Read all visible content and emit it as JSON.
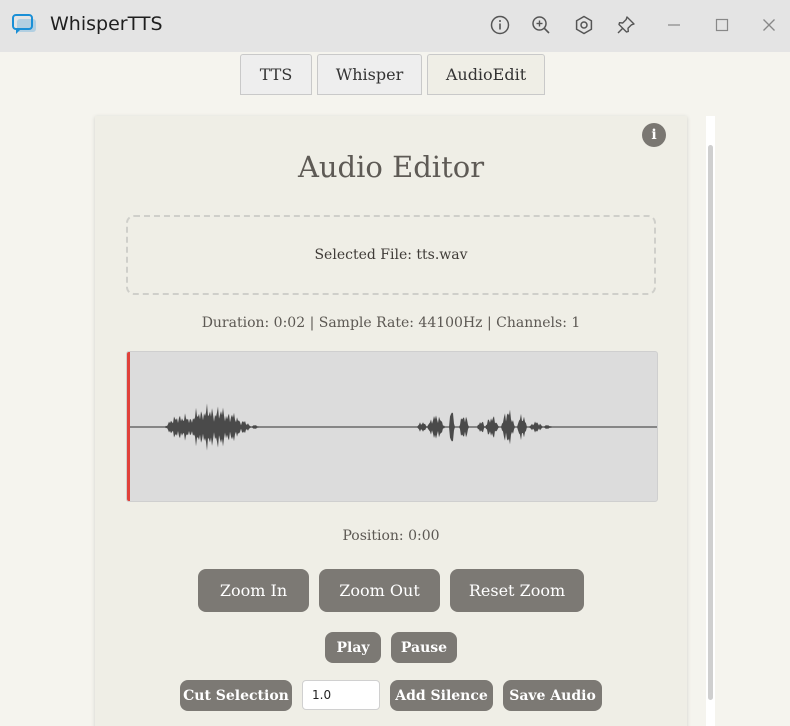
{
  "window": {
    "title": "WhisperTTS"
  },
  "tabs": [
    {
      "label": "TTS",
      "active": false
    },
    {
      "label": "Whisper",
      "active": false
    },
    {
      "label": "AudioEdit",
      "active": true
    }
  ],
  "editor": {
    "title": "Audio Editor",
    "info_label": "i",
    "selected_file": "Selected File: tts.wav",
    "meta": "Duration: 0:02 | Sample Rate: 44100Hz | Channels: 1",
    "position": "Position: 0:00"
  },
  "zoom_buttons": {
    "zoom_in": "Zoom In",
    "zoom_out": "Zoom Out",
    "reset_zoom": "Reset Zoom"
  },
  "playback": {
    "play": "Play",
    "pause": "Pause"
  },
  "edit": {
    "cut_selection": "Cut Selection",
    "silence_value": "1.0",
    "add_silence": "Add Silence",
    "save_audio": "Save Audio"
  },
  "colors": {
    "accent_icon": "#1a8fd6",
    "playhead": "#e0413a",
    "button_bg": "#7c7974",
    "waveform": "#4a4a4a"
  }
}
